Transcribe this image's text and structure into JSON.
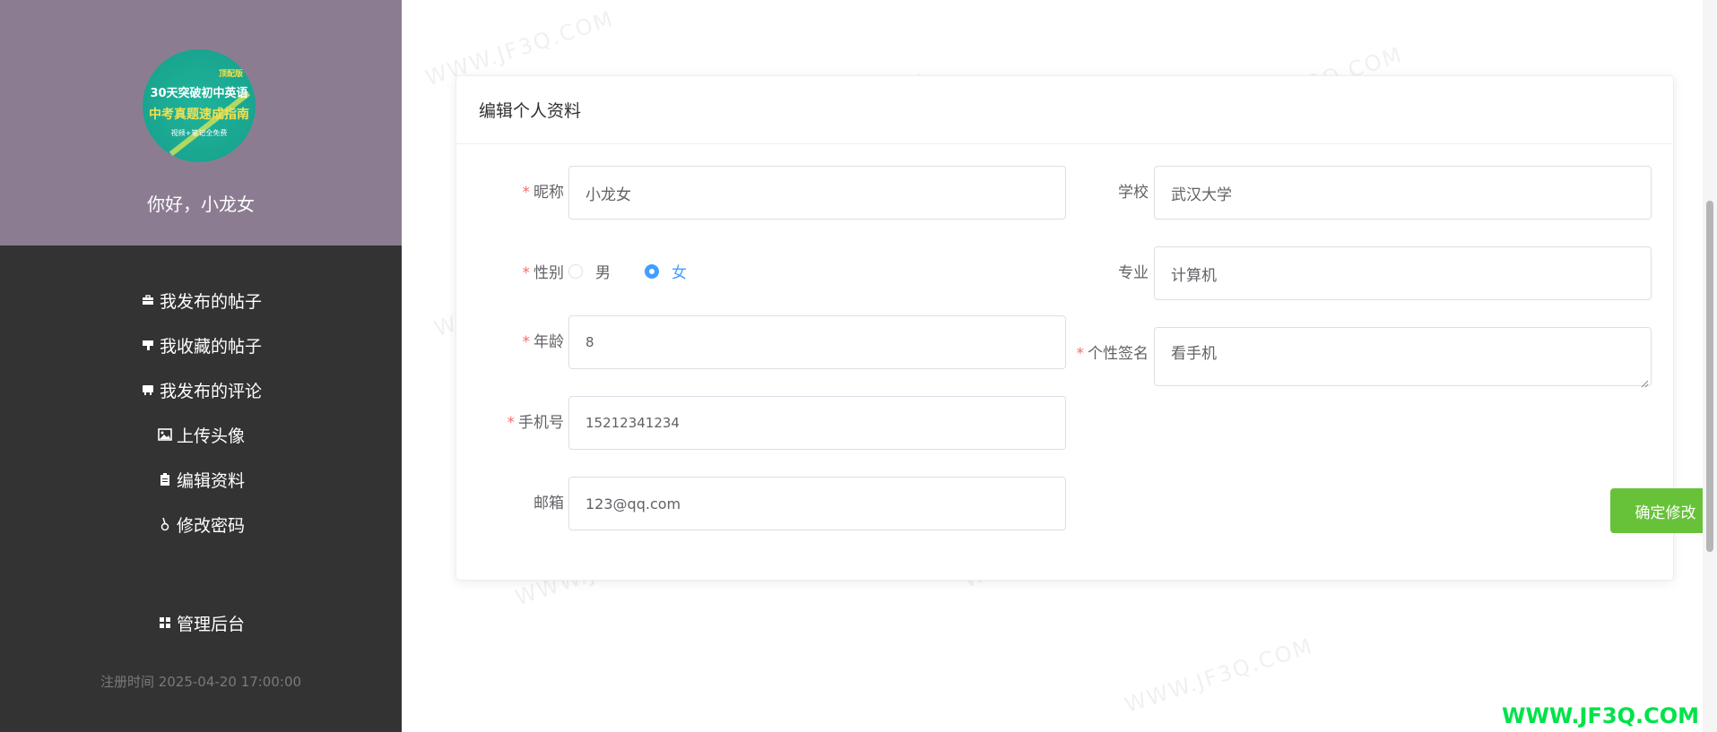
{
  "sidebar": {
    "avatar": {
      "line1": "30天突破初中英语",
      "line2": "中考真题速成指南",
      "line3": "视频+笔记全免费",
      "tag": "顶配版"
    },
    "greeting": "你好，小龙女",
    "menu": [
      {
        "label": "我发布的帖子",
        "icon": "briefcase-icon"
      },
      {
        "label": "我收藏的帖子",
        "icon": "bookmark-icon"
      },
      {
        "label": "我发布的评论",
        "icon": "comment-icon"
      },
      {
        "label": "上传头像",
        "icon": "image-icon"
      },
      {
        "label": "编辑资料",
        "icon": "clipboard-icon"
      },
      {
        "label": "修改密码",
        "icon": "key-icon"
      }
    ],
    "admin": {
      "label": "管理后台",
      "icon": "grid-icon"
    },
    "reg_time": "注册时间 2025-04-20 17:00:00"
  },
  "card": {
    "title": "编辑个人资料",
    "fields": {
      "nickname": {
        "label": "昵称",
        "value": "小龙女",
        "required": true
      },
      "gender": {
        "label": "性别",
        "options": [
          "男",
          "女"
        ],
        "selected": "女",
        "required": true
      },
      "age": {
        "label": "年龄",
        "value": "8",
        "required": true
      },
      "phone": {
        "label": "手机号",
        "value": "15212341234",
        "required": true
      },
      "email": {
        "label": "邮箱",
        "value": "123@qq.com",
        "required": false
      },
      "school": {
        "label": "学校",
        "value": "武汉大学",
        "required": false
      },
      "major": {
        "label": "专业",
        "value": "计算机",
        "required": false
      },
      "signature": {
        "label": "个性签名",
        "value": "看手机",
        "required": true
      }
    },
    "submit_label": "确定修改"
  },
  "watermark": "WWW.JF3Q.COM",
  "colors": {
    "sidebar_bg": "#333333",
    "profile_bg": "#8c7c92",
    "primary": "#409eff",
    "success": "#67c23a",
    "required": "#f56c6c"
  }
}
